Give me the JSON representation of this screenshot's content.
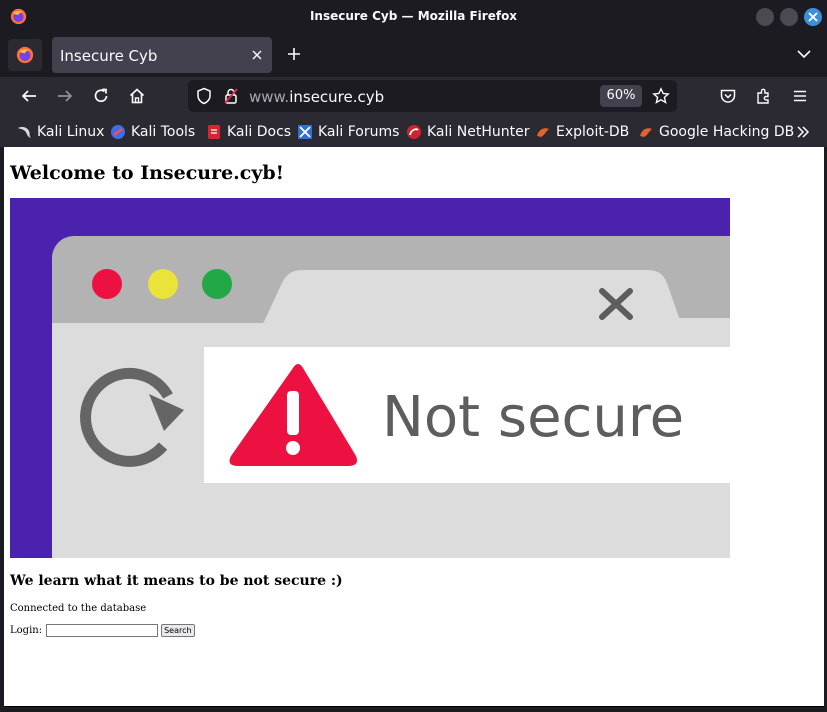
{
  "window": {
    "title": "Insecure Cyb — Mozilla Firefox"
  },
  "tabs": [
    {
      "label": "Insecure Cyb",
      "active": true
    }
  ],
  "toolbar": {
    "url_prefix": "www.",
    "url_domain": "insecure.cyb",
    "zoom": "60%"
  },
  "bookmarks": [
    {
      "label": "Kali Linux",
      "icon": "kali-dragon-icon"
    },
    {
      "label": "Kali Tools",
      "icon": "kali-tools-icon"
    },
    {
      "label": "Kali Docs",
      "icon": "kali-docs-icon"
    },
    {
      "label": "Kali Forums",
      "icon": "kali-forums-icon"
    },
    {
      "label": "Kali NetHunter",
      "icon": "nethunter-icon"
    },
    {
      "label": "Exploit-DB",
      "icon": "exploit-db-icon"
    },
    {
      "label": "Google Hacking DB",
      "icon": "ghdb-icon"
    }
  ],
  "page": {
    "heading": "Welcome to Insecure.cyb!",
    "hero_text": "Not secure",
    "subheading": "We learn what it means to be not secure :)",
    "status": "Connected to the database",
    "login_label": "Login:",
    "login_value": "",
    "search_button": "Search"
  },
  "colors": {
    "hero_background": "#4a22ad",
    "browser_frame": "#b3b3b3",
    "warning_red": "#ec1140",
    "dot_red": "#ec1140",
    "dot_yellow": "#e9e33a",
    "dot_green": "#22a846"
  }
}
